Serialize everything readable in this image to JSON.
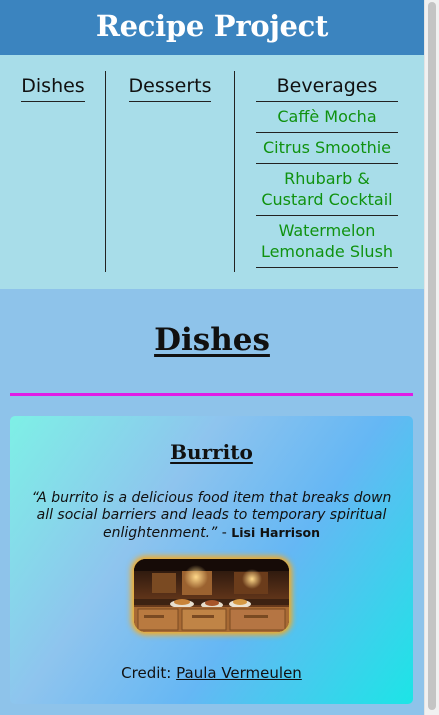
{
  "header": {
    "title": "Recipe Project"
  },
  "nav": {
    "dishes_label": "Dishes",
    "desserts_label": "Desserts",
    "beverages_label": "Beverages",
    "beverages": [
      "Caffè Mocha",
      "Citrus Smoothie",
      "Rhubarb & Custard Cocktail",
      "Watermelon Lemonade Slush"
    ],
    "link_color": "#109210"
  },
  "main": {
    "section_title": "Dishes",
    "rule_color": "#e01ce6",
    "card": {
      "title": "Burrito",
      "quote": "“A burrito is a delicious food item that breaks down all social barriers and leads to temporary spiritual enlightenment.”",
      "quote_separator": " - ",
      "author": "Lisi Harrison",
      "credit_label": "Credit:",
      "credit_name": "Paula Vermeulen"
    }
  },
  "colors": {
    "header_bg": "#3b84bf",
    "nav_bg": "#a8dde9",
    "main_bg": "#8ec3ea"
  }
}
